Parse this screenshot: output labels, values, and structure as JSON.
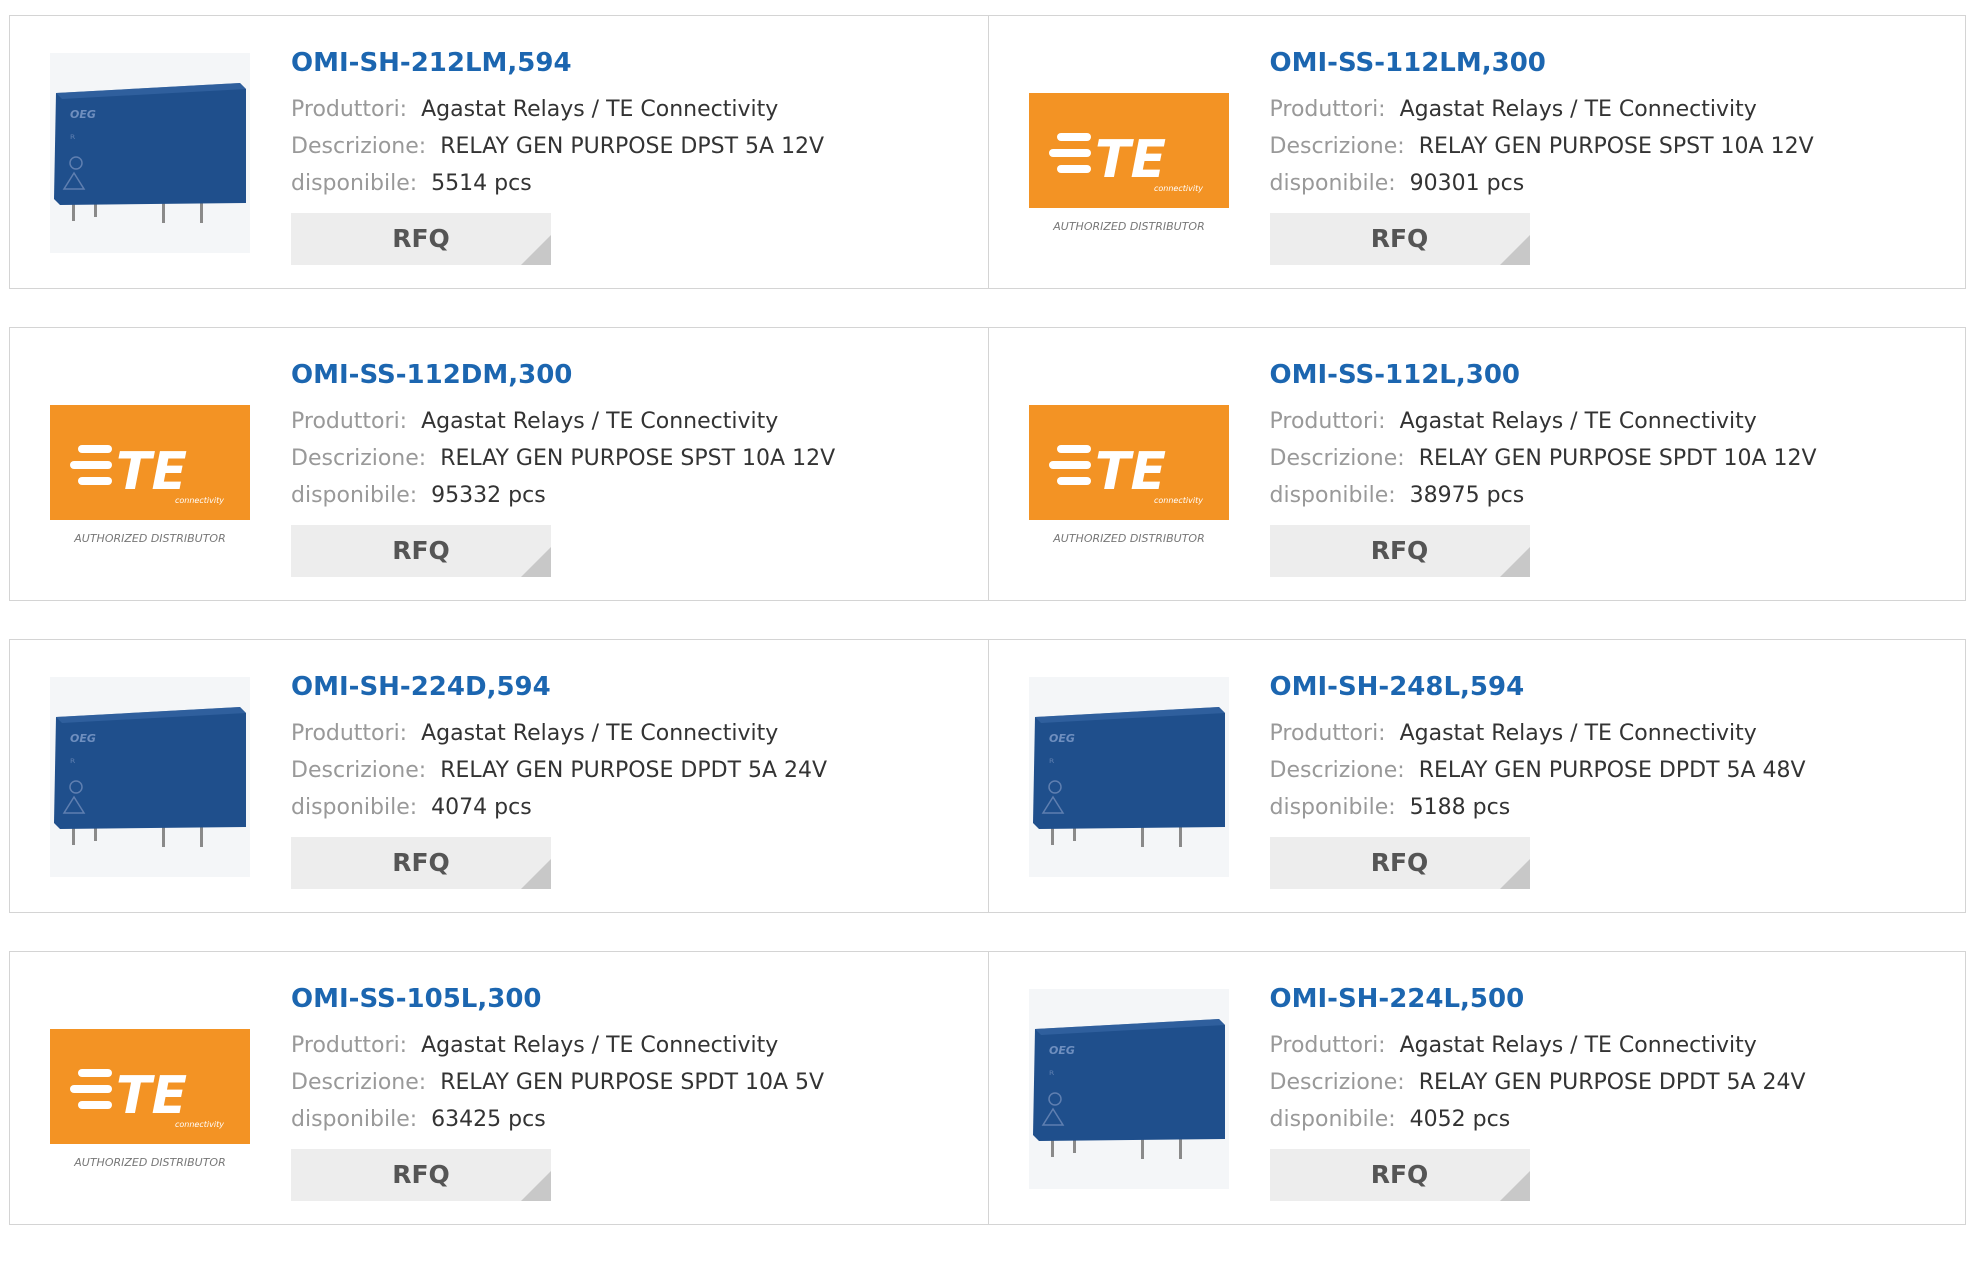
{
  "labels": {
    "manufacturer": "Produttori:",
    "description": "Descrizione:",
    "available": "disponibile:",
    "rfq": "RFQ"
  },
  "te_logo": {
    "letters": "TE",
    "sub": "connectivity",
    "caption": "AUTHORIZED DISTRIBUTOR",
    "color": "#f39324"
  },
  "relay_marks": {
    "brand": "OEG",
    "color": "#1f4f8c"
  },
  "products": [
    {
      "part": "OMI-SH-212LM,594",
      "manufacturer": "Agastat Relays / TE Connectivity",
      "description": "RELAY GEN PURPOSE DPST 5A 12V",
      "stock": "5514 pcs",
      "image": "relay"
    },
    {
      "part": "OMI-SS-112LM,300",
      "manufacturer": "Agastat Relays / TE Connectivity",
      "description": "RELAY GEN PURPOSE SPST 10A 12V",
      "stock": "90301 pcs",
      "image": "te-logo"
    },
    {
      "part": "OMI-SS-112DM,300",
      "manufacturer": "Agastat Relays / TE Connectivity",
      "description": "RELAY GEN PURPOSE SPST 10A 12V",
      "stock": "95332 pcs",
      "image": "te-logo"
    },
    {
      "part": "OMI-SS-112L,300",
      "manufacturer": "Agastat Relays / TE Connectivity",
      "description": "RELAY GEN PURPOSE SPDT 10A 12V",
      "stock": "38975 pcs",
      "image": "te-logo"
    },
    {
      "part": "OMI-SH-224D,594",
      "manufacturer": "Agastat Relays / TE Connectivity",
      "description": "RELAY GEN PURPOSE DPDT 5A 24V",
      "stock": "4074 pcs",
      "image": "relay"
    },
    {
      "part": "OMI-SH-248L,594",
      "manufacturer": "Agastat Relays / TE Connectivity",
      "description": "RELAY GEN PURPOSE DPDT 5A 48V",
      "stock": "5188 pcs",
      "image": "relay"
    },
    {
      "part": "OMI-SS-105L,300",
      "manufacturer": "Agastat Relays / TE Connectivity",
      "description": "RELAY GEN PURPOSE SPDT 10A 5V",
      "stock": "63425 pcs",
      "image": "te-logo"
    },
    {
      "part": "OMI-SH-224L,500",
      "manufacturer": "Agastat Relays / TE Connectivity",
      "description": "RELAY GEN PURPOSE DPDT 5A 24V",
      "stock": "4052 pcs",
      "image": "relay"
    }
  ]
}
